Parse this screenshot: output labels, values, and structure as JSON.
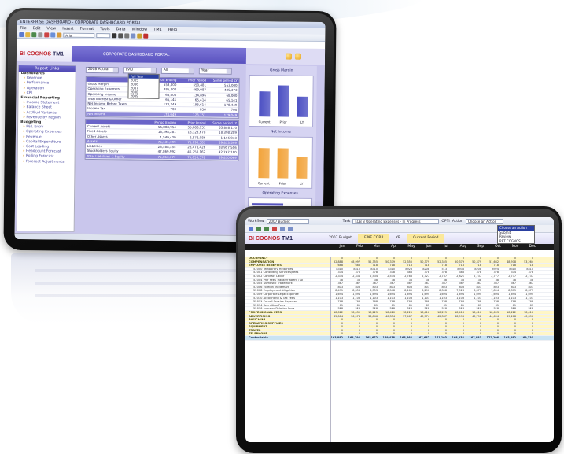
{
  "back_screen": {
    "window_title": "ENTERPRISE DASHBOARD - CORPORATE DASHBOARD PORTAL",
    "menu": [
      "File",
      "Edit",
      "View",
      "Insert",
      "Format",
      "Tools",
      "Data",
      "Window",
      "TM1",
      "Help"
    ],
    "toolbar_field": "Arial",
    "brand": {
      "name": "BI COGNOS",
      "tm": "TM1"
    },
    "portal_title": "CORPORATE DASHBOARD PORTAL",
    "sidebar": {
      "header": "Report Links",
      "items": [
        {
          "label": "Dashboards",
          "kind": "grp"
        },
        {
          "label": "Revenue",
          "kind": "sub"
        },
        {
          "label": "Performance",
          "kind": "sub"
        },
        {
          "label": "Operation",
          "kind": "sub"
        },
        {
          "label": "CPI",
          "kind": "sub"
        },
        {
          "label": "Financial Reporting",
          "kind": "grp"
        },
        {
          "label": "Income Statement",
          "kind": "sub"
        },
        {
          "label": "Balance Sheet",
          "kind": "sub"
        },
        {
          "label": "Act/Bud Variance",
          "kind": "sub"
        },
        {
          "label": "Revenue by Region",
          "kind": "sub"
        },
        {
          "label": "Budgeting",
          "kind": "grp"
        },
        {
          "label": "P&L Entry",
          "kind": "sub"
        },
        {
          "label": "Operating Expenses",
          "kind": "sub"
        },
        {
          "label": "Revenue",
          "kind": "sub"
        },
        {
          "label": "Capital Expenditure",
          "kind": "sub"
        },
        {
          "label": "Cost Loading",
          "kind": "sub"
        },
        {
          "label": "Headcount Forecast",
          "kind": "sub"
        },
        {
          "label": "Rolling Forecast",
          "kind": "sub"
        },
        {
          "label": "Forecast Adjustments",
          "kind": "sub"
        }
      ]
    },
    "filters": [
      "2008 Actual",
      "Lvl0",
      "All",
      "Year"
    ],
    "dropdown_options": [
      "Full Year",
      "2005",
      "2006",
      "2007",
      "2008",
      "2009"
    ],
    "income_table": {
      "headers": [
        "",
        "Period Ending",
        "Prior Period",
        "Same period LY"
      ],
      "rows": [
        [
          "Gross Margin",
          "553,000",
          "550,481",
          "553,000"
        ],
        [
          "Operating Expenses",
          "485,000",
          "469,087",
          "485,373"
        ],
        [
          "Operating Income",
          "68,000",
          "134,896",
          "68,000"
        ],
        [
          "Total Interest & Other",
          "65,141",
          "65,414",
          "65,141"
        ],
        [
          "Net Income Before Taxes",
          "178,749",
          "193,614",
          "178,449"
        ],
        [
          "Income Tax",
          "700",
          "856",
          "700"
        ],
        [
          "Net Income",
          "178,049",
          "178,751",
          "179,049"
        ]
      ],
      "highlight_rows": [
        6
      ]
    },
    "balance_table": {
      "headers": [
        "",
        "Period Ending",
        "Prior Period",
        "Same period LY"
      ],
      "rows": [
        [
          "Current Assets",
          "55,888,954",
          "55,888,951",
          "55,888,170"
        ],
        [
          "Fixed Assets",
          "18,398,281",
          "18,323,678",
          "18,398,289"
        ],
        [
          "Other Assets",
          "1,549,429",
          "2,978,086",
          "1,166,073"
        ],
        [
          "Assets",
          "75,131,199",
          "75,893,381",
          "69,853,599"
        ],
        [
          "Liabilities",
          "28,588,355",
          "28,478,426",
          "28,957,506"
        ],
        [
          "Stockholders Equity",
          "47,869,992",
          "46,750,162",
          "42,767,180"
        ],
        [
          "Total Liabilities & Equity",
          "75,653,377",
          "75,853,378",
          "69,870,069"
        ]
      ],
      "highlight_rows": [
        3,
        6
      ]
    },
    "charts": [
      {
        "title": "Gross Margin",
        "color": "#4b4fc3",
        "bars": [
          {
            "label": "Current",
            "value": 72
          },
          {
            "label": "Prior",
            "value": 92
          },
          {
            "label": "LY",
            "value": 60
          }
        ]
      },
      {
        "title": "Net Income",
        "color": "#f2a33a",
        "bars": [
          {
            "label": "Current",
            "value": 86
          },
          {
            "label": "Prior",
            "value": 86
          },
          {
            "label": "LY",
            "value": 62
          }
        ]
      }
    ],
    "third_panel_title": "Operating Expenses"
  },
  "front_screen": {
    "top_left": "Workflow",
    "version_select": "2007 Budget",
    "cube_label": "Task",
    "task_select": "LOB 3 Operating Expenses - In Progress",
    "user_label": "OPTI",
    "action_label": "Action",
    "action_select": "Choose an Action",
    "action_menu": [
      "Choose an Action",
      "Submit",
      "Review",
      "",
      "RPT COGNOS"
    ],
    "brand": {
      "name": "BI COGNOS",
      "tm": "TM1"
    },
    "header_cells": [
      "2007 Budget",
      "FINE CORP",
      "YR",
      "Current Period"
    ],
    "months": [
      "Jan",
      "Feb",
      "Mar",
      "Apr",
      "May",
      "Jun",
      "Jul",
      "Aug",
      "Sep",
      "Oct",
      "Nov",
      "Dec"
    ],
    "rows": [
      {
        "label": "OCCUPANCY",
        "kind": "sec",
        "vals": [
          "0",
          "0",
          "0",
          "0",
          "0",
          "0",
          "0",
          "0",
          "0",
          "0",
          "0",
          "0"
        ]
      },
      {
        "label": "COMPENSATION",
        "kind": "sec",
        "vals": [
          "52,888",
          "48,997",
          "52,355",
          "50,379",
          "52,355",
          "50,379",
          "52,355",
          "50,379",
          "50,379",
          "51,662",
          "48,978",
          "53,264"
        ]
      },
      {
        "label": "EMPLOYEE BENEFITS",
        "kind": "sec",
        "vals": [
          "688",
          "688",
          "718",
          "718",
          "718",
          "718",
          "718",
          "718",
          "718",
          "718",
          "718",
          "718"
        ]
      },
      {
        "label": "52000 Temporary Help Fees",
        "kind": "sub",
        "vals": [
          "8310",
          "8310",
          "8310",
          "8310",
          "8923",
          "8208",
          "7513",
          "8938",
          "8208",
          "8924",
          "8310",
          "8310"
        ]
      },
      {
        "label": "52001 Consulting Services/Fees",
        "kind": "sub",
        "vals": [
          "374",
          "378",
          "378",
          "378",
          "388",
          "378",
          "378",
          "388",
          "378",
          "378",
          "374",
          "378"
        ]
      },
      {
        "label": "52002 Contract Labor",
        "kind": "sub",
        "vals": [
          "2,334",
          "2,334",
          "2,534",
          "2,534",
          "2,788",
          "2,727",
          "2,737",
          "2,821",
          "2,737",
          "2,777",
          "2,737",
          "2,737"
        ]
      },
      {
        "label": "52004 Prof Fees Transfer agent / DI",
        "kind": "sub",
        "vals": [
          "38",
          "38",
          "38",
          "38",
          "38",
          "38",
          "38",
          "38",
          "38",
          "38",
          "38",
          "38"
        ]
      },
      {
        "label": "52005 Domestic Trademark",
        "kind": "sub",
        "vals": [
          "367",
          "367",
          "367",
          "367",
          "367",
          "367",
          "367",
          "367",
          "367",
          "367",
          "367",
          "367"
        ]
      },
      {
        "label": "52006 Foreign Trademark",
        "kind": "sub",
        "vals": [
          "803",
          "803",
          "803",
          "803",
          "803",
          "803",
          "803",
          "803",
          "803",
          "803",
          "803",
          "803"
        ]
      },
      {
        "label": "52008 Employment Litigation",
        "kind": "sub",
        "vals": [
          "8,491",
          "8,358",
          "8,553",
          "8,548",
          "8,165",
          "8,290",
          "8,358",
          "7,928",
          "8,373",
          "7,894",
          "8,375",
          "8,373"
        ]
      },
      {
        "label": "52009 Corporate Legal Expense",
        "kind": "sub",
        "vals": [
          "1,694",
          "1,694",
          "1,694",
          "1,694",
          "1,694",
          "1,694",
          "1,694",
          "1,694",
          "1,694",
          "1,694",
          "1,694",
          "1,694"
        ]
      },
      {
        "label": "52010 Accounting & Tax Fees",
        "kind": "sub",
        "vals": [
          "1,103",
          "1,103",
          "1,103",
          "1,103",
          "1,103",
          "1,103",
          "1,103",
          "1,103",
          "1,103",
          "1,103",
          "1,103",
          "1,103"
        ]
      },
      {
        "label": "52011 Payroll Service Expense",
        "kind": "sub",
        "vals": [
          "768",
          "768",
          "768",
          "768",
          "768",
          "768",
          "768",
          "768",
          "768",
          "768",
          "768",
          "768"
        ]
      },
      {
        "label": "52014 Recruiting Fees",
        "kind": "sub",
        "vals": [
          "61",
          "61",
          "61",
          "61",
          "61",
          "61",
          "61",
          "61",
          "61",
          "61",
          "61",
          "61"
        ]
      },
      {
        "label": "52016 Investor Relation Fees",
        "kind": "sub",
        "vals": [
          "528",
          "528",
          "528",
          "528",
          "528",
          "528",
          "528",
          "528",
          "528",
          "528",
          "528",
          "528"
        ]
      },
      {
        "label": "PROFESSIONAL FEES",
        "kind": "sec",
        "vals": [
          "18,022",
          "18,039",
          "18,225",
          "18,420",
          "18,225",
          "18,416",
          "18,225",
          "18,416",
          "18,416",
          "18,693",
          "18,222",
          "18,416"
        ]
      },
      {
        "label": "ADVERTISING",
        "kind": "sec",
        "vals": [
          "35,084",
          "36,974",
          "36,846",
          "40,334",
          "37,467",
          "40,774",
          "42,337",
          "38,993",
          "40,798",
          "44,694",
          "39,268",
          "40,396"
        ]
      },
      {
        "label": "SAMPLING",
        "kind": "sec",
        "vals": [
          "0",
          "0",
          "0",
          "0",
          "0",
          "0",
          "0",
          "0",
          "0",
          "0",
          "0",
          "0"
        ]
      },
      {
        "label": "OPERATING SUPPLIES",
        "kind": "sec",
        "vals": [
          "0",
          "0",
          "0",
          "0",
          "0",
          "0",
          "0",
          "0",
          "0",
          "0",
          "0",
          "0"
        ]
      },
      {
        "label": "EQUIPMENT",
        "kind": "sec",
        "vals": [
          "0",
          "0",
          "0",
          "0",
          "0",
          "0",
          "0",
          "0",
          "0",
          "0",
          "0",
          "0"
        ]
      },
      {
        "label": "TRAVEL",
        "kind": "sec",
        "vals": [
          "0",
          "0",
          "0",
          "0",
          "0",
          "0",
          "0",
          "0",
          "0",
          "0",
          "0",
          "0"
        ]
      },
      {
        "label": "TELEPHONE",
        "kind": "sec",
        "vals": [
          "0",
          "0",
          "0",
          "0",
          "0",
          "0",
          "0",
          "0",
          "0",
          "0",
          "0",
          "0"
        ]
      },
      {
        "label": "Controllable",
        "kind": "total",
        "vals": [
          "163,882",
          "164,298",
          "165,672",
          "169,438",
          "166,564",
          "167,687",
          "171,103",
          "168,234",
          "167,881",
          "172,206",
          "165,882",
          "169,330"
        ]
      }
    ]
  }
}
